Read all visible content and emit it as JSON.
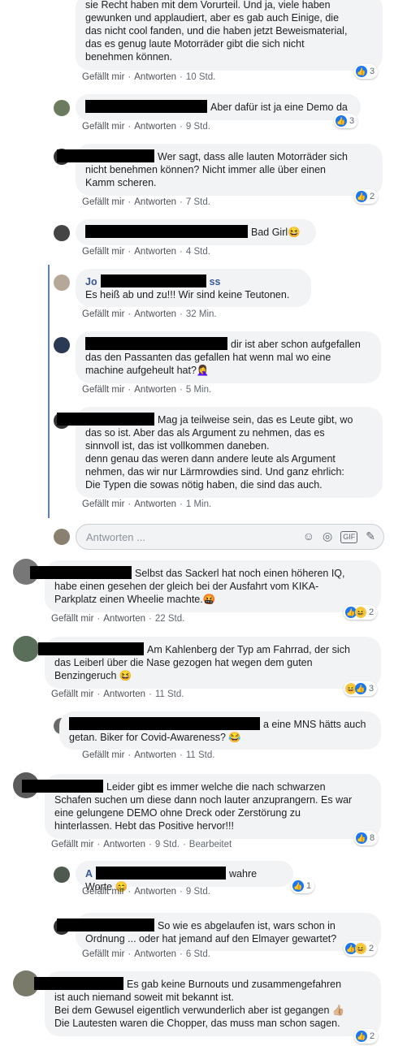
{
  "comments": [
    {
      "id": "c0",
      "text": "sie Recht haben mit dem Vorurteil. Und ja, viele haben\ngewunken und applaudiert, aber es gab auch Einige, die\ndas nicht cool fanden, und die haben jetzt Beweismaterial,\ndas es genug laute Motorräder gibt die sich nicht\nbenehmen können.",
      "like": "Gefällt mir",
      "reply": "Antworten",
      "time": "10 Std.",
      "reactions": "3"
    },
    {
      "id": "c1",
      "text": "Aber dafür ist ja eine Demo da",
      "like": "Gefällt mir",
      "reply": "Antworten",
      "time": "9 Std.",
      "reactions": "3"
    },
    {
      "id": "c2",
      "text": "Wer sagt, dass alle lauten Motorräder sich\nnicht benehmen können? Nicht immer alle über einen\nKamm scheren.",
      "like": "Gefällt mir",
      "reply": "Antworten",
      "time": "7 Std.",
      "reactions": "2"
    },
    {
      "id": "c3",
      "text": "Bad Girl😆",
      "like": "Gefällt mir",
      "reply": "Antworten",
      "time": "4 Std."
    },
    {
      "id": "c4",
      "author_prefix": "Jo",
      "author_suffix": "ss",
      "text": "Es heiß ab und zu!!! Wir sind keine Teutonen.",
      "like": "Gefällt mir",
      "reply": "Antworten",
      "time": "32 Min."
    },
    {
      "id": "c5",
      "text": "dir ist aber schon aufgefallen\ndas den Passanten das gefallen hat wenn mal wo eine\nmachine aufgeheult hat?🤦‍♀️",
      "like": "Gefällt mir",
      "reply": "Antworten",
      "time": "5 Min."
    },
    {
      "id": "c6",
      "text": "Mag ja teilweise sein, das es Leute gibt, wo\ndas so ist. Aber das als Argument zu nehmen, das es\nsinnvoll ist, das ist vollkommen daneben.\ndenn genau das weren dann andere leute als Argument\nnehmen, das wir nur Lärmrowdies sind. Und ganz ehrlich:\nDie Typen die sowas nötig haben, die sind das auch.",
      "like": "Gefällt mir",
      "reply": "Antworten",
      "time": "1 Min."
    },
    {
      "id": "c7",
      "text": "Selbst das Sackerl hat noch einen höheren IQ,\nhabe einen gesehen der gleich bei der Ausfahrt vom KIKA-\nParkplatz einen Wheelie machte.🤬",
      "like": "Gefällt mir",
      "reply": "Antworten",
      "time": "22 Std.",
      "reactions": "2"
    },
    {
      "id": "c8",
      "text": "Am Kahlenberg der Typ am Fahrrad, der sich\ndas Leiberl über die Nase gezogen hat wegen dem guten\nBenzingeruch 😆",
      "like": "Gefällt mir",
      "reply": "Antworten",
      "time": "11 Std.",
      "reactions": "3"
    },
    {
      "id": "c9",
      "text": "a eine MNS hätts auch\ngetan. Biker for Covid-Awareness? 😂",
      "like": "Gefällt mir",
      "reply": "Antworten",
      "time": "11 Std."
    },
    {
      "id": "c10",
      "text": "Leider gibt es immer welche die nach schwarzen\nSchafen suchen um diese dann noch lauter anzuprangern. Es war\neine gelungene DEMO ohne Dreck oder Zerstörung zu\nhinterlassen. Hebt das Positive hervor!!!",
      "like": "Gefällt mir",
      "reply": "Antworten",
      "time": "9 Std.",
      "edited": "Bearbeitet",
      "reactions": "8"
    },
    {
      "id": "c11",
      "author_prefix": "A",
      "text": "wahre Worte 😊",
      "like": "Gefällt mir",
      "reply": "Antworten",
      "time": "9 Std.",
      "reactions": "1"
    },
    {
      "id": "c12",
      "text": "So wie es abgelaufen ist, wars schon in\nOrdnung ... oder hat jemand auf den Elmayer gewartet?",
      "like": "Gefällt mir",
      "reply": "Antworten",
      "time": "6 Std.",
      "reactions": "2"
    },
    {
      "id": "c13",
      "text": "Es gab keine Burnouts und zusammengefahren\nist auch niemand soweit mit bekannt ist.\nBei dem Gewusel eigentlich verwunderlich aber ist gegangen 👍🏼\nDie Lautesten waren die Chopper, das muss man schon sagen.",
      "reactions": "2"
    }
  ],
  "reply_box": {
    "placeholder": "Antworten ...",
    "icons": [
      "emoji-icon",
      "camera-icon",
      "gif-icon",
      "sticker-icon"
    ]
  },
  "colors": {
    "bubble": "#f2f3f5",
    "link": "#385898",
    "like": "#1877f2",
    "thread": "#5b7bd5"
  }
}
